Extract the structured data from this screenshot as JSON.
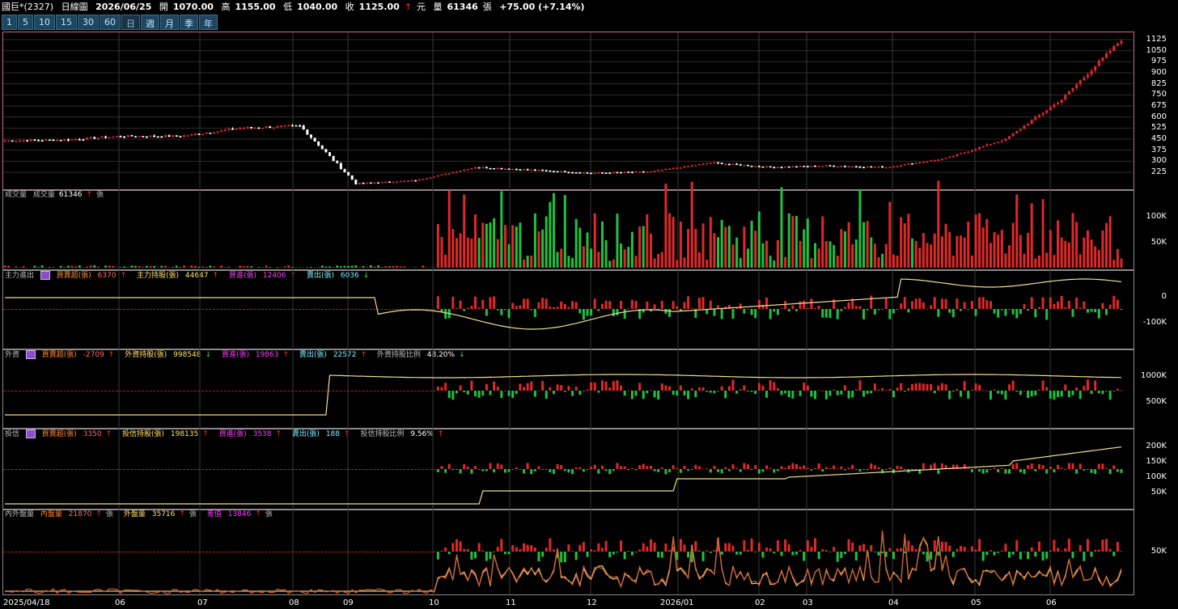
{
  "header": {
    "stock": "國巨*(2327)",
    "period": "日線圖",
    "date": "2026/06/25",
    "open_label": "開",
    "open": "1070.00",
    "high_label": "高",
    "high": "1155.00",
    "low_label": "低",
    "low": "1040.00",
    "close_label": "收",
    "close": "1125.00",
    "close_unit": "元",
    "volume_label": "量",
    "volume": "61346",
    "volume_unit": "張",
    "change": "+75.00 (+7.14%)"
  },
  "toolbar": {
    "buttons": [
      "1",
      "5",
      "10",
      "15",
      "30",
      "60",
      "日",
      "週",
      "月",
      "季",
      "年"
    ],
    "selected": "日"
  },
  "panels": {
    "volume": {
      "label": "成交量",
      "item_label": "成交量",
      "value": "61346",
      "unit": "張"
    },
    "main_force": {
      "label": "主力進出",
      "buy_sell_label": "買賣超(張)",
      "buy_sell": "6370",
      "holding_label": "主力持股(張)",
      "holding": "44647",
      "buy_label": "買進(張)",
      "buy": "12406",
      "sell_label": "賣出(張)",
      "sell": "6036"
    },
    "foreign": {
      "label": "外資",
      "buy_sell_label": "買賣超(張)",
      "buy_sell": "-2709",
      "holding_label": "外資持股(張)",
      "holding": "998548",
      "buy_label": "買進(張)",
      "buy": "19863",
      "sell_label": "賣出(張)",
      "sell": "22572",
      "ratio_label": "外資持股比例",
      "ratio": "48.20%"
    },
    "trust": {
      "label": "投信",
      "buy_sell_label": "買賣超(張)",
      "buy_sell": "3350",
      "holding_label": "投信持股(張)",
      "holding": "198135",
      "buy_label": "買進(張)",
      "buy": "3538",
      "sell_label": "賣出(張)",
      "sell": "188",
      "ratio_label": "投信持股比例",
      "ratio": "9.56%"
    },
    "inout": {
      "label": "內外盤量",
      "in_label": "內盤量",
      "in": "21870",
      "in_unit": "張",
      "out_label": "外盤量",
      "out": "35716",
      "out_unit": "張",
      "diff_label": "差值",
      "diff": "13846",
      "diff_unit": "張"
    }
  },
  "chart_data": {
    "type": "line",
    "price_axis_ticks": [
      "1125",
      "1050",
      "975",
      "900",
      "825",
      "750",
      "675",
      "600",
      "525",
      "450",
      "375",
      "300",
      "225"
    ],
    "volume_axis_ticks": [
      "100K",
      "50K"
    ],
    "main_force_axis_ticks": [
      "0",
      "-100K"
    ],
    "foreign_axis_ticks": [
      "1000K",
      "500K"
    ],
    "trust_axis_ticks": [
      "200K",
      "150K",
      "100K",
      "50K"
    ],
    "inout_axis_ticks": [
      "50K"
    ],
    "x_labels": [
      "2025/04/18",
      "06",
      "07",
      "08",
      "09",
      "10",
      "11",
      "12",
      "2026/01",
      "02",
      "03",
      "04",
      "05",
      "06"
    ],
    "price_anchors": {
      "x": [
        "2025/04/18",
        "2025/05",
        "2025/06",
        "2025/07",
        "2025/08",
        "2025/08 late",
        "2025/09",
        "2025/10",
        "2025/10 mid",
        "2025/11",
        "2025/12",
        "2026/01",
        "2026/01 late",
        "2026/02",
        "2026/03",
        "2026/04",
        "2026/05",
        "2026/05 mid",
        "2026/06",
        "2026/06/25"
      ],
      "close": [
        440,
        445,
        470,
        470,
        525,
        540,
        150,
        170,
        260,
        240,
        220,
        230,
        290,
        260,
        270,
        260,
        320,
        450,
        720,
        1125
      ]
    },
    "colors": {
      "up": "#e02828",
      "down": "#20c040",
      "line": "#f0e090",
      "neutral": "#ffffff"
    }
  }
}
